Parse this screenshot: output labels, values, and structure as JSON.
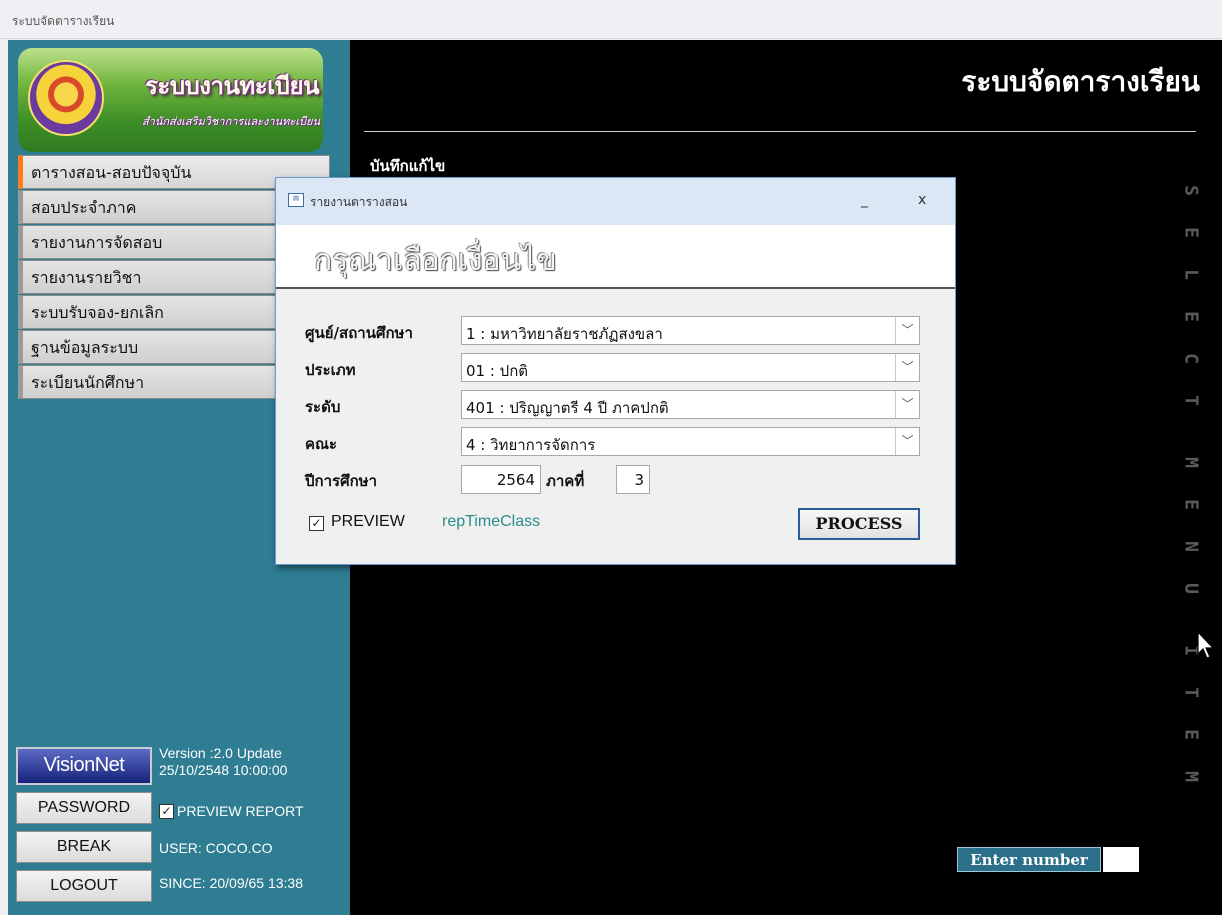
{
  "window": {
    "title": "ระบบจัดตารางเรียน"
  },
  "logo": {
    "title": "ระบบงานทะเบียน",
    "subtitle": "สำนักส่งเสริมวิชาการและงานทะเบียน"
  },
  "sidebar": {
    "items": [
      {
        "label": "ตารางสอน-สอบปัจจุบัน",
        "active": true
      },
      {
        "label": "สอบประจำภาค"
      },
      {
        "label": "รายงานการจัดสอบ"
      },
      {
        "label": "รายงานรายวิชา"
      },
      {
        "label": "ระบบรับจอง-ยกเลิก"
      },
      {
        "label": "ฐานข้อมูลระบบ"
      },
      {
        "label": "ระเบียนนักศึกษา"
      }
    ]
  },
  "main": {
    "title": "ระบบจัดตารางเรียน",
    "edit_label": "บันทึกแก้ไข",
    "vertical_letters": [
      "S",
      "E",
      "L",
      "E",
      "C",
      "T",
      "M",
      "E",
      "N",
      "U",
      "I",
      "T",
      "E",
      "M"
    ],
    "enter_number_label": "Enter number"
  },
  "bottom": {
    "brand": "VisionNet",
    "version_line1": "Version :2.0 Update",
    "version_line2": "25/10/2548 10:00:00",
    "password_button": "PASSWORD",
    "preview_report_label": "PREVIEW REPORT",
    "preview_report_checked": true,
    "break_button": "BREAK",
    "user": "USER: COCO.CO",
    "logout_button": "LOGOUT",
    "since": "SINCE: 20/09/65 13:38"
  },
  "dialog": {
    "title": "รายงานตารางสอน",
    "minimize": "_",
    "close": "x",
    "heading": "กรุณาเลือกเงื่อนไข",
    "fields": {
      "center_label": "ศูนย์/สถานศึกษา",
      "center_value": "1 : มหาวิทยาลัยราชภัฏสงขลา",
      "type_label": "ประเภท",
      "type_value": "01 : ปกติ",
      "level_label": "ระดับ",
      "level_value": "401 : ปริญญาตรี 4  ปี ภาคปกติ",
      "faculty_label": "คณะ",
      "faculty_value": "4 : วิทยาการจัดการ",
      "year_label": "ปีการศึกษา",
      "year_value": "2564",
      "term_label": "ภาคที่",
      "term_value": "3"
    },
    "preview_label": "PREVIEW",
    "preview_checked": true,
    "report_name": "repTimeClass",
    "process_button": "PROCESS"
  },
  "colors": {
    "sidebar_bg": "#2e7d92",
    "main_bg": "#000000",
    "active_menu_accent": "#ff7b1c",
    "report_name": "#2a8d8d"
  }
}
